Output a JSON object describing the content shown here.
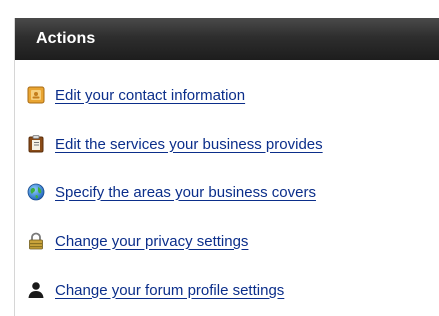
{
  "panel": {
    "title": "Actions"
  },
  "actions": [
    {
      "label": "Edit your contact information",
      "icon": "contact-card-icon"
    },
    {
      "label": "Edit the services your business provides",
      "icon": "clipboard-icon"
    },
    {
      "label": "Specify the areas your business covers",
      "icon": "globe-icon"
    },
    {
      "label": "Change your privacy settings",
      "icon": "lock-icon"
    },
    {
      "label": "Change your forum profile settings",
      "icon": "user-silhouette-icon"
    }
  ],
  "colors": {
    "link": "#0b2e8a",
    "header_bg": "#1d1d1d",
    "header_text": "#ffffff"
  }
}
